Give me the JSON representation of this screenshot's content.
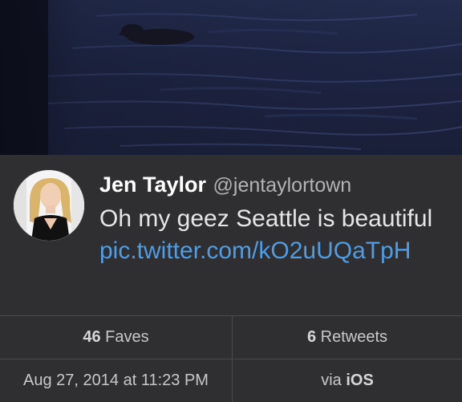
{
  "tweet": {
    "name": "Jen Taylor",
    "handle": "@jentaylortown",
    "text_plain": "Oh my geez Seattle is beautiful ",
    "text_link": "pic.twitter.com/kO2uUQaTpH"
  },
  "stats": {
    "faves_count": "46",
    "faves_label": "Faves",
    "retweets_count": "6",
    "retweets_label": "Retweets",
    "timestamp": "Aug 27, 2014 at 11:23 PM",
    "via_prefix": "via",
    "via_source": "iOS"
  },
  "colors": {
    "link": "#4f9ee5",
    "background": "#2f2f31"
  }
}
